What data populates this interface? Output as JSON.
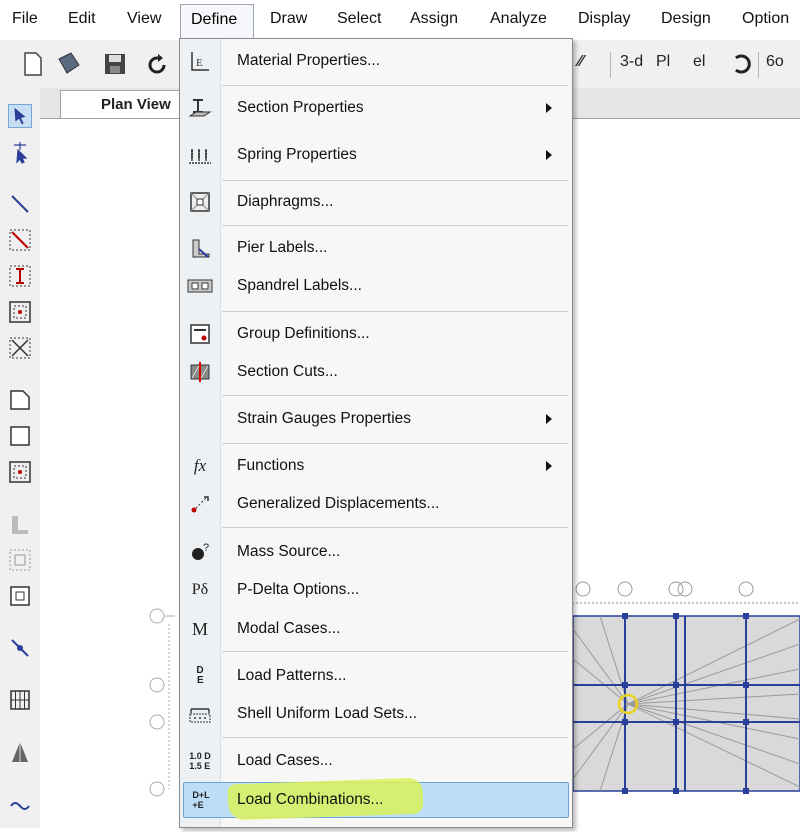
{
  "menubar": {
    "items": [
      "File",
      "Edit",
      "View",
      "Define",
      "Draw",
      "Select",
      "Assign",
      "Analyze",
      "Display",
      "Design",
      "Option"
    ]
  },
  "toolbar": {
    "labels": [
      "3-d",
      "Pl",
      "el",
      "6o"
    ]
  },
  "tabs": {
    "plan_view": "Plan View"
  },
  "define_menu": {
    "items": [
      {
        "label": "Material Properties...",
        "icon": "material-properties-icon",
        "submenu": false
      },
      {
        "label": "Section Properties",
        "icon": "section-properties-icon",
        "submenu": true
      },
      {
        "label": "Spring Properties",
        "icon": "spring-properties-icon",
        "submenu": true
      },
      {
        "label": "Diaphragms...",
        "icon": "diaphragm-icon",
        "submenu": false
      },
      {
        "label": "Pier Labels...",
        "icon": "pier-labels-icon",
        "submenu": false
      },
      {
        "label": "Spandrel Labels...",
        "icon": "spandrel-labels-icon",
        "submenu": false
      },
      {
        "label": "Group Definitions...",
        "icon": "group-definitions-icon",
        "submenu": false
      },
      {
        "label": "Section Cuts...",
        "icon": "section-cuts-icon",
        "submenu": false
      },
      {
        "label": "Strain Gauges Properties",
        "icon": "",
        "submenu": true
      },
      {
        "label": "Functions",
        "icon": "functions-icon",
        "submenu": true
      },
      {
        "label": "Generalized Displacements...",
        "icon": "generalized-displacements-icon",
        "submenu": false
      },
      {
        "label": "Mass Source...",
        "icon": "mass-source-icon",
        "submenu": false
      },
      {
        "label": "P-Delta Options...",
        "icon": "p-delta-icon",
        "submenu": false
      },
      {
        "label": "Modal Cases...",
        "icon": "modal-cases-icon",
        "submenu": false
      },
      {
        "label": "Load Patterns...",
        "icon": "load-patterns-icon",
        "submenu": false
      },
      {
        "label": "Shell Uniform Load Sets...",
        "icon": "shell-load-sets-icon",
        "submenu": false
      },
      {
        "label": "Load Cases...",
        "icon": "load-cases-icon",
        "submenu": false
      },
      {
        "label": "Load Combinations...",
        "icon": "load-combinations-icon",
        "submenu": false,
        "highlighted": true
      }
    ],
    "icon_text": {
      "pdelta": "Pδ",
      "modal": "M",
      "fx": "fx",
      "patterns": "D\nE",
      "cases": "1.0 D\n1.5 E",
      "combos": "D+L\n+E"
    }
  },
  "colors": {
    "menu_highlight": "#bddcf6",
    "marker_highlight": "#d9f25a",
    "model_fill": "#d9d9d9",
    "frame_blue": "#2a3f9a"
  }
}
